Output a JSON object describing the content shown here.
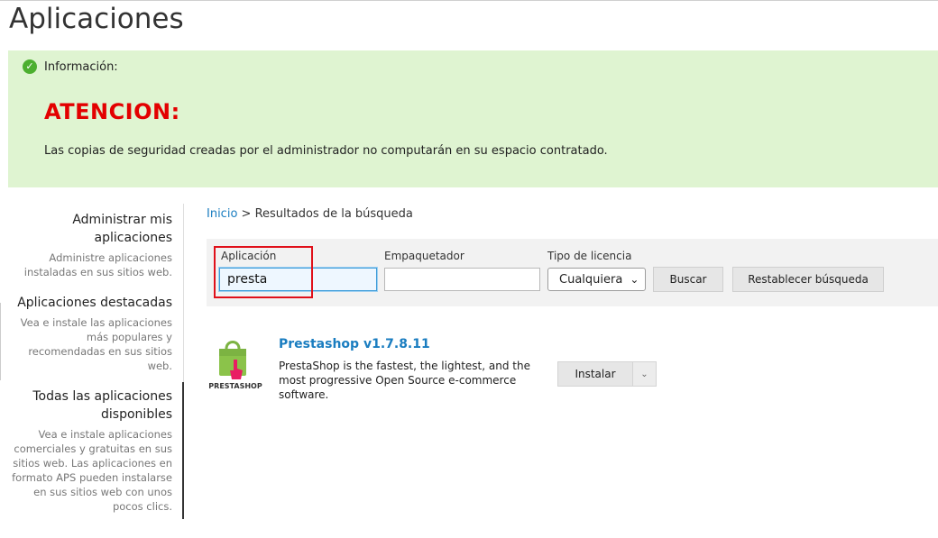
{
  "page": {
    "title": "Aplicaciones"
  },
  "info": {
    "label": "Información:",
    "heading": "ATENCION:",
    "text": "Las copias de seguridad creadas por el administrador no computarán en su espacio contratado."
  },
  "sidebar": {
    "items": [
      {
        "title": "Administrar mis aplicaciones",
        "desc": "Administre aplicaciones instaladas en sus sitios web."
      },
      {
        "title": "Aplicaciones destacadas",
        "desc": "Vea e instale las aplicaciones más populares y recomendadas en sus sitios web."
      },
      {
        "title": "Todas las aplicaciones disponibles",
        "desc": "Vea e instale aplicaciones comerciales y gratuitas en sus sitios web. Las aplicaciones en formato APS pueden instalarse en sus sitios web con unos pocos clics."
      }
    ]
  },
  "breadcrumb": {
    "home": "Inicio",
    "separator": " > ",
    "current": "Resultados de la búsqueda"
  },
  "search": {
    "app_label": "Aplicación",
    "app_value": "presta",
    "packager_label": "Empaquetador",
    "packager_value": "",
    "license_label": "Tipo de licencia",
    "license_value": "Cualquiera",
    "search_button": "Buscar",
    "reset_button": "Restablecer búsqueda"
  },
  "results": [
    {
      "name": "Prestashop v1.7.8.11",
      "desc": "PrestaShop is the fastest, the lightest, and the most progressive Open Source e-commerce software.",
      "logo_text": "PRESTASHOP",
      "install_label": "Instalar"
    }
  ],
  "colors": {
    "info_bg": "#dff4d1",
    "alert": "#e30000",
    "link": "#1a7dc0",
    "highlight": "#e0101a"
  }
}
